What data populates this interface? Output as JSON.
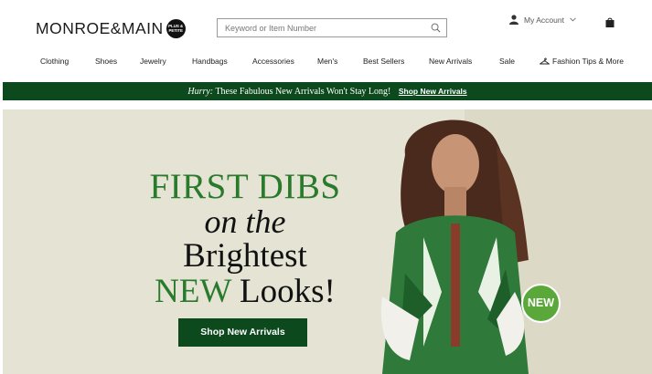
{
  "brand": {
    "name": "MONROE&MAIN",
    "badge": "PLUS & PETITE"
  },
  "search": {
    "placeholder": "Keyword or Item Number"
  },
  "account": {
    "label": "My Account"
  },
  "nav": [
    {
      "label": "Clothing"
    },
    {
      "label": "Shoes"
    },
    {
      "label": "Jewelry"
    },
    {
      "label": "Handbags"
    },
    {
      "label": "Accessories"
    },
    {
      "label": "Men's"
    },
    {
      "label": "Best Sellers"
    },
    {
      "label": "New Arrivals"
    },
    {
      "label": "Sale"
    },
    {
      "label": "Fashion Tips & More"
    }
  ],
  "promo": {
    "hurry": "Hurry:",
    "message": "These Fabulous New Arrivals Won't Stay Long!",
    "link": "Shop New Arrivals"
  },
  "hero": {
    "line1": "FIRST DIBS",
    "line2": "on the",
    "line3": "Brightest",
    "line4_green": "NEW",
    "line4_rest": "Looks!",
    "cta": "Shop New Arrivals",
    "badge": "NEW"
  },
  "colors": {
    "brand_green": "#0c4a1d",
    "accent_green": "#2a7a2c",
    "badge_green": "#5aa83a",
    "hero_bg": "#e4e3d4"
  },
  "icons": {
    "search": "search-icon",
    "user": "user-icon",
    "bag": "shopping-bag-icon",
    "hanger": "hanger-icon",
    "chevron": "chevron-down-icon"
  }
}
